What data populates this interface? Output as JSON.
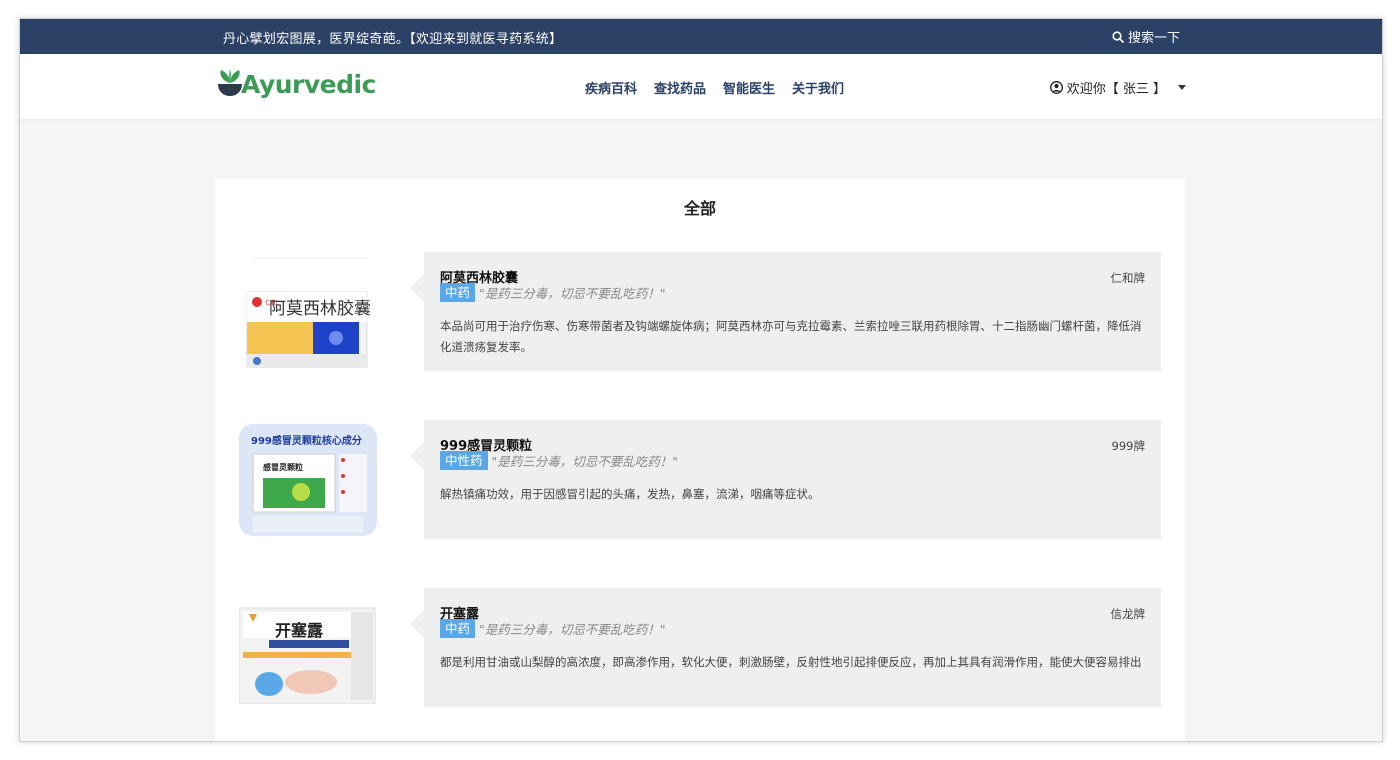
{
  "topbar": {
    "notice": "丹心擘划宏图展，医界绽奇葩。【欢迎来到就医寻药系统】",
    "search_label": "搜索一下"
  },
  "header": {
    "logo_text": "Ayurvedic",
    "nav": [
      "疾病百科",
      "查找药品",
      "智能医生",
      "关于我们"
    ],
    "user_label": "欢迎你【 张三 】"
  },
  "content": {
    "title": "全部",
    "drugs": [
      {
        "name": "阿莫西林胶囊",
        "brand": "仁和牌",
        "type": "中药",
        "quote": "\"是药三分毒，切忌不要乱吃药！\"",
        "desc": "本品尚可用于治疗伤寒、伤寒带菌者及钩端螺旋体病；阿莫西林亦可与克拉霉素、兰索拉唑三联用药根除胃、十二指肠幽门螺杆菌，降低消化道溃疡复发率。",
        "image_label": "阿莫西林胶囊"
      },
      {
        "name": "999感冒灵颗粒",
        "brand": "999牌",
        "type": "中性药",
        "quote": "\"是药三分毒，切忌不要乱吃药！\"",
        "desc": "解热镇痛功效，用于因感冒引起的头痛，发热，鼻塞，流涕，咽痛等症状。",
        "image_label": "999感冒灵颗粒核心成分"
      },
      {
        "name": "开塞露",
        "brand": "信龙牌",
        "type": "中药",
        "quote": "\"是药三分毒，切忌不要乱吃药！\"",
        "desc": "都是利用甘油或山梨醇的高浓度，即高渗作用，软化大便，刺激肠壁，反射性地引起排便反应，再加上其具有润滑作用，能使大便容易排出",
        "image_label": "开塞露"
      }
    ]
  },
  "colors": {
    "topbar_bg": "#2b4165",
    "logo_green": "#3d9b57",
    "badge_blue": "#5aa7e8"
  },
  "icons": {
    "search": "search-icon",
    "user": "user-circle-icon",
    "caret": "caret-down-icon",
    "logo": "leaf-bowl-icon"
  }
}
